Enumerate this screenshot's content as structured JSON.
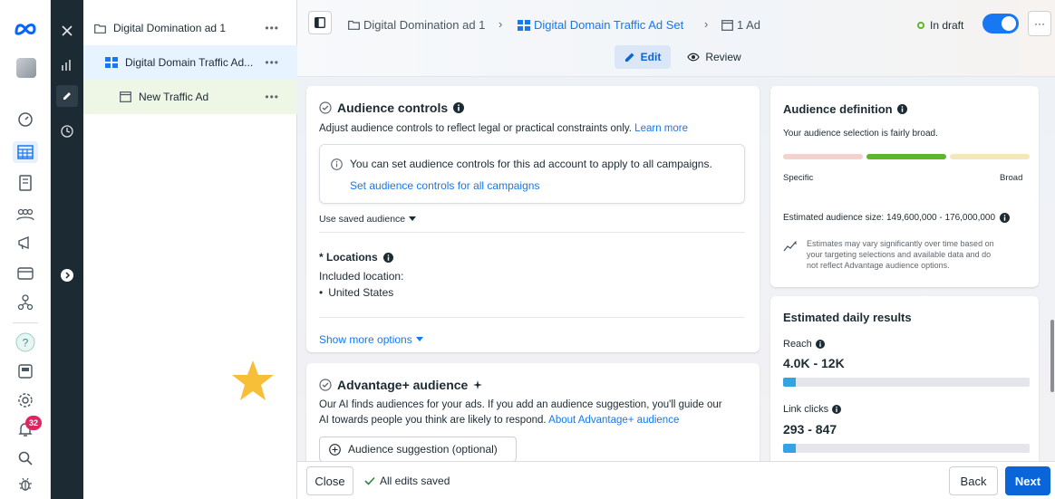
{
  "tree": {
    "items": [
      {
        "label": "Digital Domination ad 1",
        "more": "•••"
      },
      {
        "label": "Digital Domain Traffic Ad...",
        "more": "•••"
      },
      {
        "label": "New Traffic Ad",
        "more": "•••"
      }
    ]
  },
  "rail": {
    "notification_count": "32"
  },
  "header": {
    "breadcrumb": {
      "campaign": "Digital Domination ad 1",
      "adset": "Digital Domain Traffic Ad Set",
      "ad": "1 Ad"
    },
    "status": "In draft",
    "more": "···",
    "tabs": {
      "edit": "Edit",
      "review": "Review"
    }
  },
  "audience_controls": {
    "title": "Audience controls",
    "description": "Adjust audience controls to reflect legal or practical constraints only.",
    "learn_more": "Learn more",
    "info_text": "You can set audience controls for this ad account to apply to all campaigns.",
    "info_link": "Set audience controls for all campaigns",
    "saved_audience": "Use saved audience",
    "locations_title": "* Locations",
    "included_label": "Included location:",
    "location": "United States",
    "show_more": "Show more options"
  },
  "advantage": {
    "title": "Advantage+ audience",
    "description_1": "Our AI finds audiences for your ads. If you add an audience suggestion, you'll guide our",
    "description_2": "AI towards people you think are likely to respond.",
    "about_link": "About Advantage+ audience",
    "suggestion_button": "Audience suggestion (optional)"
  },
  "audience_definition": {
    "title": "Audience definition",
    "subtitle": "Your audience selection is fairly broad.",
    "specific": "Specific",
    "broad": "Broad",
    "estimated_size": "Estimated audience size: 149,600,000 - 176,000,000",
    "note": [
      "Estimates may vary significantly over time based on",
      "your targeting selections and available data and do",
      "not reflect Advantage audience options."
    ]
  },
  "daily_results": {
    "title": "Estimated daily results",
    "reach_label": "Reach",
    "reach_value": "4.0K - 12K",
    "reach_fill": 0.05,
    "clicks_label": "Link clicks",
    "clicks_value": "293 - 847",
    "clicks_fill": 0.05
  },
  "footer": {
    "close": "Close",
    "saved": "All edits saved",
    "back": "Back",
    "next": "Next"
  },
  "colors": {
    "brand": "#0a66d8",
    "link": "#1877f2",
    "gauge_active": "#5db52a",
    "star": "#f7be38"
  }
}
